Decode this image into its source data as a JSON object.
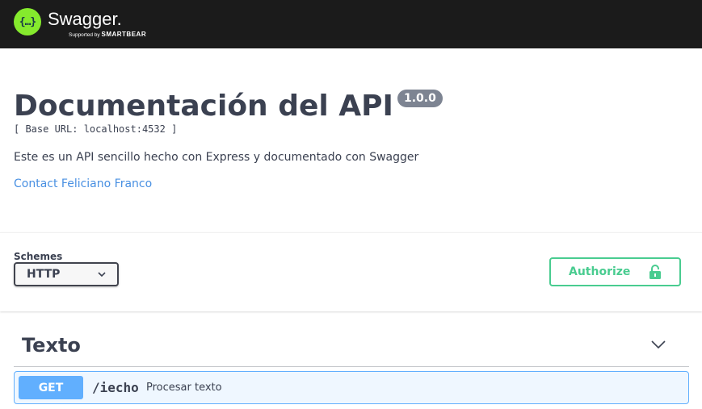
{
  "topbar": {
    "logo_glyph": "{…}",
    "logo_name": "Swagger",
    "logo_tm": ".",
    "logo_supported": "Supported by",
    "logo_company": "SMARTBEAR"
  },
  "info": {
    "title": "Documentación del API",
    "version": "1.0.0",
    "base_url": "[ Base URL: localhost:4532 ]",
    "description": "Este es un API sencillo hecho con Express y documentado con Swagger",
    "contact": "Contact Feliciano Franco"
  },
  "schemes": {
    "label": "Schemes",
    "selected": "HTTP"
  },
  "authorize": {
    "label": "Authorize"
  },
  "tags": [
    {
      "name": "Texto",
      "operations": [
        {
          "method": "GET",
          "path": "/iecho",
          "summary": "Procesar texto"
        }
      ]
    }
  ],
  "colors": {
    "topbar_bg": "#1b1b1b",
    "logo_green": "#85ea2d",
    "authorize_green": "#49cc90",
    "get_blue": "#61affe",
    "link_blue": "#4990e2",
    "text": "#3b4151",
    "version_badge": "#7d8492"
  },
  "icons": {
    "schemes_dropdown": "chevron-down-icon",
    "authorize": "unlock-icon",
    "tag_toggle": "chevron-down-icon"
  }
}
